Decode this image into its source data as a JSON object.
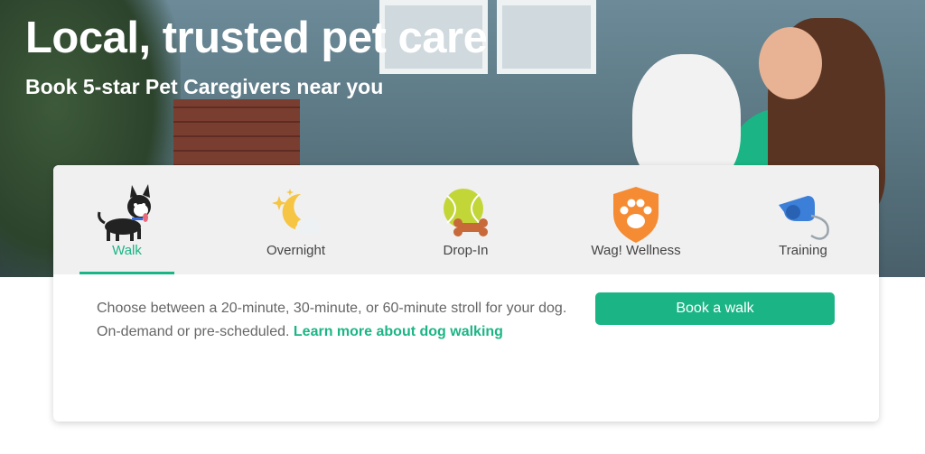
{
  "hero": {
    "title": "Local, trusted pet care",
    "subtitle": "Book 5-star Pet Caregivers near you"
  },
  "tabs": [
    {
      "label": "Walk",
      "icon": "dog-walking-icon",
      "active": true
    },
    {
      "label": "Overnight",
      "icon": "moon-stars-icon",
      "active": false
    },
    {
      "label": "Drop-In",
      "icon": "tennis-ball-bone-icon",
      "active": false
    },
    {
      "label": "Wag! Wellness",
      "icon": "paw-shield-icon",
      "active": false
    },
    {
      "label": "Training",
      "icon": "whistle-icon",
      "active": false
    }
  ],
  "panel": {
    "description": "Choose between a 20-minute, 30-minute, or 60-minute stroll for your dog. On-demand or pre-scheduled.",
    "learn_more": "Learn more about dog walking",
    "button_label": "Book a walk"
  },
  "colors": {
    "accent": "#1bb585",
    "tab_bar_bg": "#f0f0f0",
    "body_text": "#666666"
  }
}
